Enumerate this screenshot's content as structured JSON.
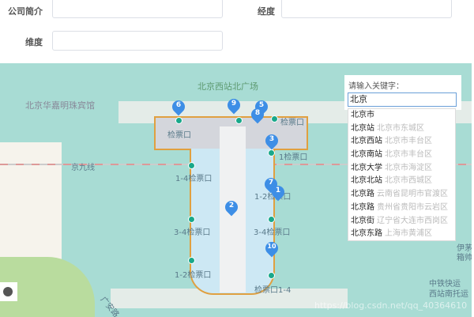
{
  "form": {
    "company_intro_label": "公司简介",
    "longitude_label": "经度",
    "latitude_label": "维度",
    "company_intro_value": "",
    "longitude_value": "",
    "latitude_value": ""
  },
  "map": {
    "labels": {
      "square": "北京西站北广场",
      "hotel": "北京华嘉明珠宾馆",
      "rail": "京九线",
      "g1": "检票口",
      "g2": "检票口",
      "g3": "1检票口",
      "g4": "1-4检票口",
      "g5": "1-2检票口",
      "g6": "3-4检票口",
      "g7": "3-4检票口",
      "g8": "1-2检票口",
      "g9": "检票口1-4",
      "r1": "伊茅",
      "r2": "箱帅",
      "r3": "中铁快运",
      "r4": "西站南托运",
      "road": "广安路"
    },
    "markers": [
      "6",
      "9",
      "5",
      "8",
      "3",
      "7",
      "1",
      "2",
      "10"
    ],
    "watermark": "https://blog.csdn.net/qq_40364610"
  },
  "search": {
    "prompt": "请输入关键字：",
    "value": "北京",
    "suggestions": [
      {
        "name": "北京市",
        "area": ""
      },
      {
        "name": "北京站",
        "area": "北京市东城区"
      },
      {
        "name": "北京西站",
        "area": "北京市丰台区"
      },
      {
        "name": "北京南站",
        "area": "北京市丰台区"
      },
      {
        "name": "北京大学",
        "area": "北京市海淀区"
      },
      {
        "name": "北京北站",
        "area": "北京市西城区"
      },
      {
        "name": "北京路",
        "area": "云南省昆明市官渡区"
      },
      {
        "name": "北京路",
        "area": "贵州省贵阳市云岩区"
      },
      {
        "name": "北京街",
        "area": "辽宁省大连市西岗区"
      },
      {
        "name": "北京东路",
        "area": "上海市黄浦区"
      }
    ]
  }
}
